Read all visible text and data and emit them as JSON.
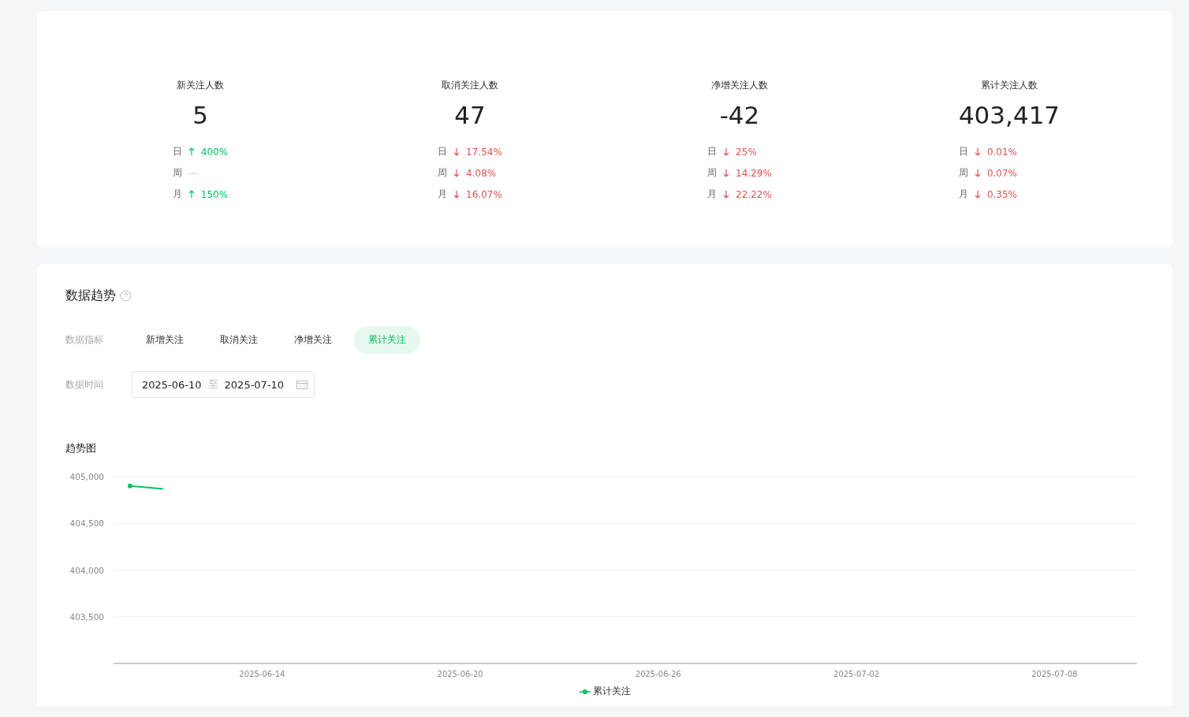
{
  "stats": [
    {
      "title": "新关注人数",
      "value": "5",
      "changes": [
        {
          "period": "日",
          "kind": "up",
          "value": "400%"
        },
        {
          "period": "周",
          "kind": "none",
          "value": "—"
        },
        {
          "period": "月",
          "kind": "up",
          "value": "150%"
        }
      ]
    },
    {
      "title": "取消关注人数",
      "value": "47",
      "changes": [
        {
          "period": "日",
          "kind": "down",
          "value": "17.54%"
        },
        {
          "period": "周",
          "kind": "down",
          "value": "4.08%"
        },
        {
          "period": "月",
          "kind": "down",
          "value": "16.07%"
        }
      ]
    },
    {
      "title": "净增关注人数",
      "value": "-42",
      "changes": [
        {
          "period": "日",
          "kind": "down",
          "value": "25%"
        },
        {
          "period": "周",
          "kind": "down",
          "value": "14.29%"
        },
        {
          "period": "月",
          "kind": "down",
          "value": "22.22%"
        }
      ]
    },
    {
      "title": "累计关注人数",
      "value": "403,417",
      "changes": [
        {
          "period": "日",
          "kind": "down",
          "value": "0.01%"
        },
        {
          "period": "周",
          "kind": "down",
          "value": "0.07%"
        },
        {
          "period": "月",
          "kind": "down",
          "value": "0.35%"
        }
      ]
    }
  ],
  "trend": {
    "title": "数据趋势",
    "metric_label": "数据指标",
    "metrics": [
      {
        "label": "新增关注",
        "selected": false
      },
      {
        "label": "取消关注",
        "selected": false
      },
      {
        "label": "净增关注",
        "selected": false
      },
      {
        "label": "累计关注",
        "selected": true
      }
    ],
    "time_label": "数据时间",
    "date_start": "2025-06-10",
    "date_separator": "至",
    "date_end": "2025-07-10",
    "chart_title": "趋势图",
    "chart_data": {
      "type": "line",
      "grid": true,
      "categories": [
        null,
        null,
        null,
        null,
        "2025-06-14",
        null,
        null,
        null,
        null,
        null,
        "2025-06-20",
        null,
        null,
        null,
        null,
        null,
        "2025-06-26",
        null,
        null,
        null,
        null,
        null,
        "2025-07-02",
        null,
        null,
        null,
        null,
        null,
        "2025-07-08",
        null,
        null
      ],
      "series": [
        {
          "name": "累计关注",
          "color": "#07c160",
          "values": [
            404900,
            404870,
            null,
            null,
            null,
            null,
            null,
            null,
            null,
            null,
            null,
            null,
            null,
            null,
            null,
            null,
            null,
            null,
            null,
            null,
            null,
            null,
            null,
            null,
            null,
            null,
            null,
            null,
            null,
            null,
            null
          ]
        }
      ],
      "ylim": [
        403000,
        405000
      ],
      "yticks": [
        {
          "value": 403500,
          "label": "403,500"
        },
        {
          "value": 404000,
          "label": "404,000"
        },
        {
          "value": 404500,
          "label": "404,500"
        },
        {
          "value": 405000,
          "label": "405,000"
        }
      ]
    }
  }
}
